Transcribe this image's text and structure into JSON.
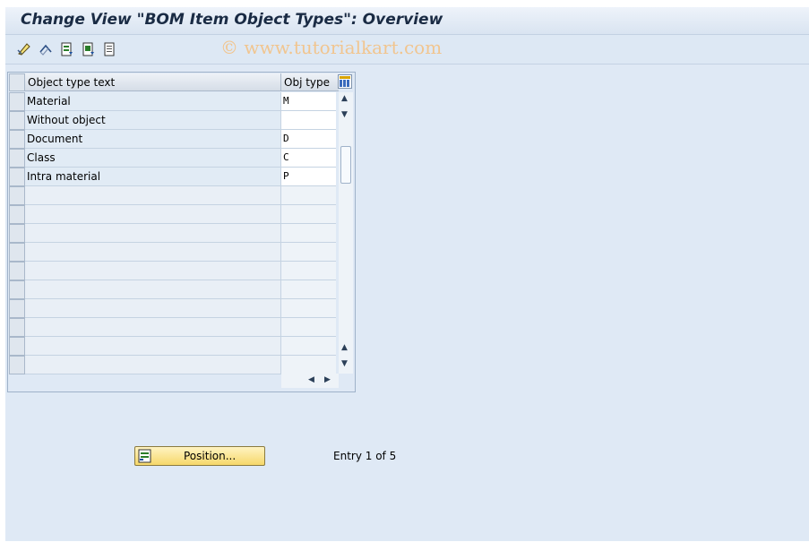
{
  "title": "Change View \"BOM Item Object Types\": Overview",
  "watermark": "© www.tutorialkart.com",
  "toolbar": {
    "icons": [
      "display-change-icon",
      "undo-change-icon",
      "select-all-icon",
      "select-block-icon",
      "deselect-all-icon"
    ]
  },
  "table": {
    "columns": [
      "Object type text",
      "Obj type"
    ],
    "rows": [
      {
        "text": "Material",
        "obj_type": "M"
      },
      {
        "text": "Without object",
        "obj_type": ""
      },
      {
        "text": "Document",
        "obj_type": "D"
      },
      {
        "text": "Class",
        "obj_type": "C"
      },
      {
        "text": "Intra material",
        "obj_type": "P"
      }
    ],
    "empty_rows": 10
  },
  "position_button": {
    "label": "Position..."
  },
  "entry_info": "Entry 1 of 5",
  "colors": {
    "accent_button": "#f6d86a",
    "background": "#dfe9f5"
  }
}
